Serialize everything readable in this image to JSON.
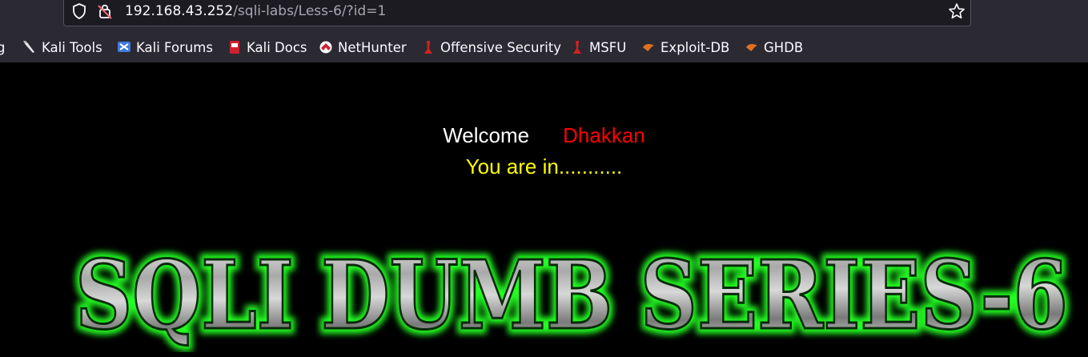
{
  "browser": {
    "url_host": "192.168.43.252",
    "url_path": "/sqli-labs/Less-6/?id=1",
    "bookmarks": [
      {
        "label": "g",
        "icon": "truncated-bookmark"
      },
      {
        "label": "Kali Tools",
        "icon": "kali-tools-icon"
      },
      {
        "label": "Kali Forums",
        "icon": "kali-forums-icon"
      },
      {
        "label": "Kali Docs",
        "icon": "kali-docs-icon"
      },
      {
        "label": "NetHunter",
        "icon": "nethunter-icon"
      },
      {
        "label": "Offensive Security",
        "icon": "offsec-icon"
      },
      {
        "label": "MSFU",
        "icon": "msfu-icon"
      },
      {
        "label": "Exploit-DB",
        "icon": "exploit-db-icon"
      },
      {
        "label": "GHDB",
        "icon": "ghdb-icon"
      }
    ]
  },
  "page": {
    "welcome_label": "Welcome",
    "username": "Dhakkan",
    "status_message": "You are in...........",
    "banner_text": "SQLI DUMB SERIES-6"
  }
}
